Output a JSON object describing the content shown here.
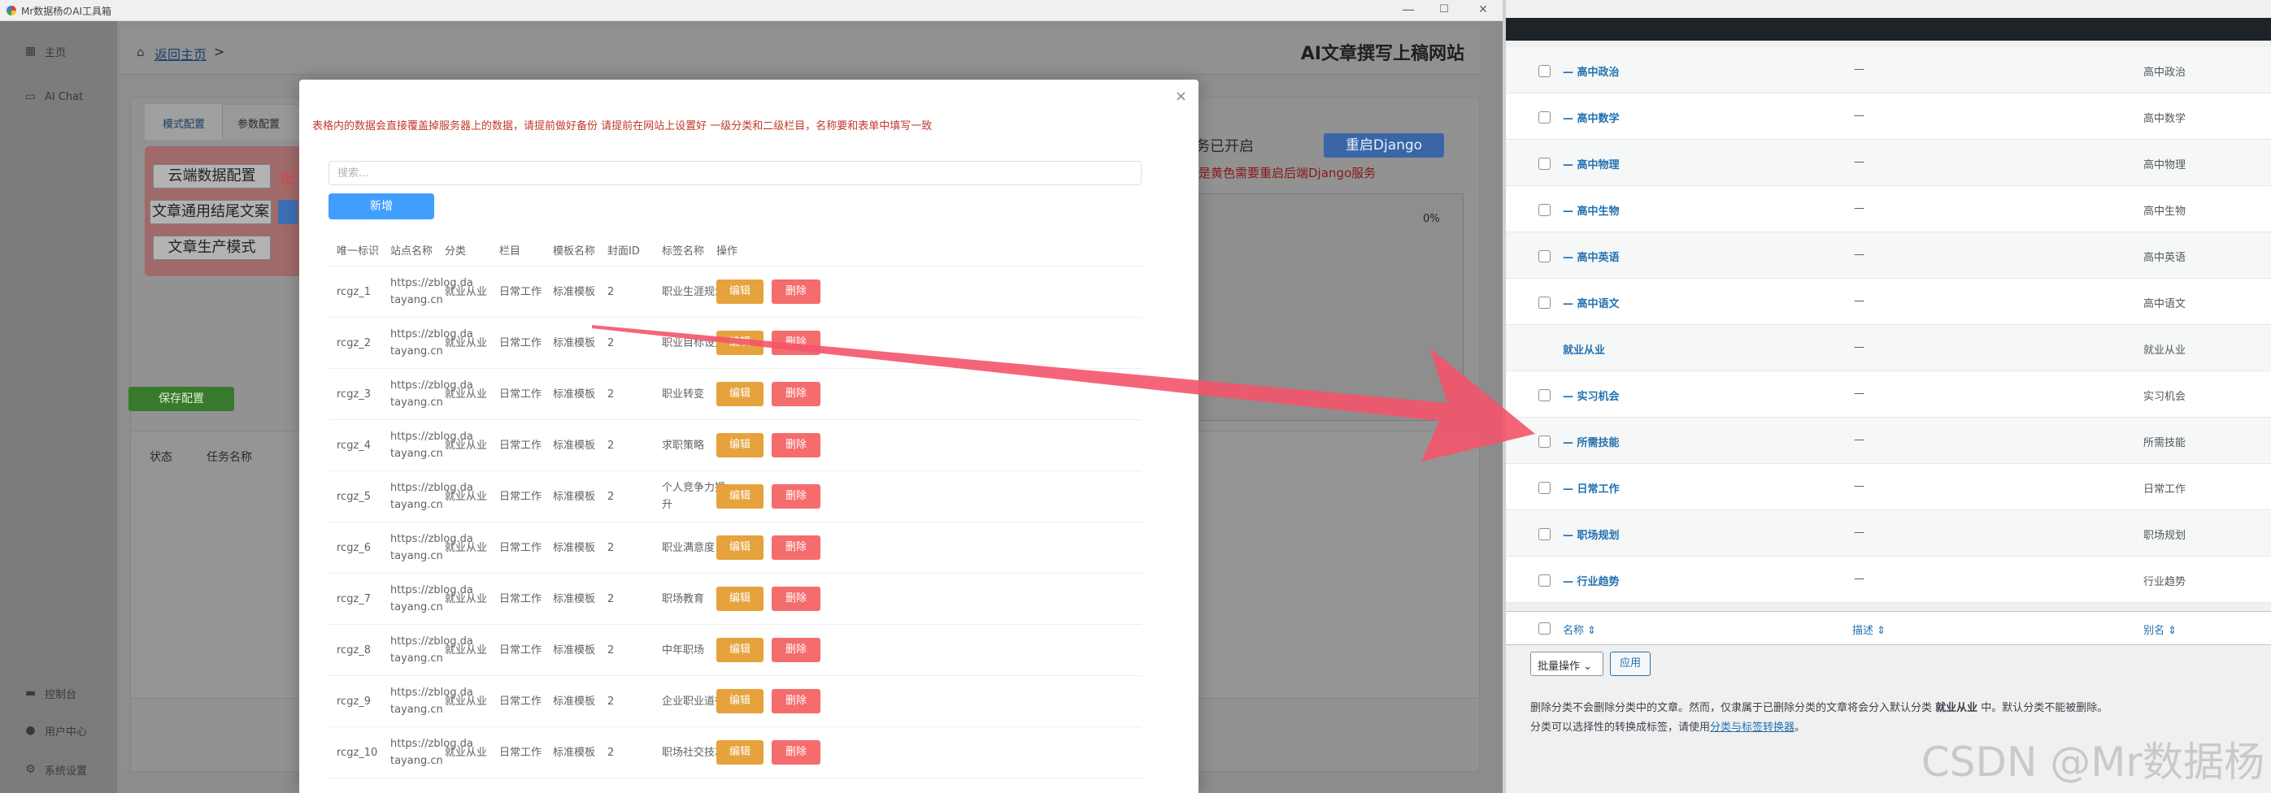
{
  "window": {
    "title": "Mr数据杨のAI工具箱",
    "controls": [
      "—",
      "☐",
      "✕"
    ]
  },
  "sidebar": {
    "items": [
      {
        "label": "主页",
        "icon": "grid-icon"
      },
      {
        "label": "AI Chat",
        "icon": "chat-icon"
      },
      {
        "label": "控制台",
        "icon": "monitor-icon"
      },
      {
        "label": "用户中心",
        "icon": "user-icon"
      },
      {
        "label": "系统设置",
        "icon": "gear-icon"
      }
    ]
  },
  "header": {
    "breadcrumb_link": "返回主页",
    "breadcrumb_sep": ">",
    "title": "AI文章撰写上稿网站"
  },
  "tabs": [
    "模式配置",
    "参数配置"
  ],
  "config_buttons": [
    "云端数据配置",
    "文章通用结尾文案",
    "文章生产模式"
  ],
  "config_tag_partial": "配",
  "save_label": "保存配置",
  "service": {
    "status_text": "务已开启",
    "restart_label": "重启Django",
    "restart_note": "是黄色需要重启后端Django服务",
    "progress_pct": "0%"
  },
  "task_table": {
    "columns": [
      "状态",
      "任务名称"
    ]
  },
  "modal": {
    "close_glyph": "×",
    "warning": "表格内的数据会直接覆盖掉服务器上的数据，请提前做好备份 请提前在网站上设置好 一级分类和二级栏目，名称要和表单中填写一致",
    "search_placeholder": "搜索...",
    "add_label": "新增",
    "columns": [
      "唯一标识",
      "站点名称",
      "分类",
      "栏目",
      "模板名称",
      "封面ID",
      "标签名称",
      "操作"
    ],
    "edit_label": "编辑",
    "delete_label": "删除",
    "rows": [
      {
        "id": "rcgz_1",
        "site_a": "https://zblog.da",
        "site_b": "tayang.cn",
        "category": "就业从业",
        "column": "日常工作",
        "template": "标准模板",
        "cover": "2",
        "tag_a": "职业生涯规划",
        "tag_b": ""
      },
      {
        "id": "rcgz_2",
        "site_a": "https://zblog.da",
        "site_b": "tayang.cn",
        "category": "就业从业",
        "column": "日常工作",
        "template": "标准模板",
        "cover": "2",
        "tag_a": "职业目标设定",
        "tag_b": ""
      },
      {
        "id": "rcgz_3",
        "site_a": "https://zblog.da",
        "site_b": "tayang.cn",
        "category": "就业从业",
        "column": "日常工作",
        "template": "标准模板",
        "cover": "2",
        "tag_a": "职业转变",
        "tag_b": ""
      },
      {
        "id": "rcgz_4",
        "site_a": "https://zblog.da",
        "site_b": "tayang.cn",
        "category": "就业从业",
        "column": "日常工作",
        "template": "标准模板",
        "cover": "2",
        "tag_a": "求职策略",
        "tag_b": ""
      },
      {
        "id": "rcgz_5",
        "site_a": "https://zblog.da",
        "site_b": "tayang.cn",
        "category": "就业从业",
        "column": "日常工作",
        "template": "标准模板",
        "cover": "2",
        "tag_a": "个人竞争力提",
        "tag_b": "升"
      },
      {
        "id": "rcgz_6",
        "site_a": "https://zblog.da",
        "site_b": "tayang.cn",
        "category": "就业从业",
        "column": "日常工作",
        "template": "标准模板",
        "cover": "2",
        "tag_a": "职业满意度",
        "tag_b": ""
      },
      {
        "id": "rcgz_7",
        "site_a": "https://zblog.da",
        "site_b": "tayang.cn",
        "category": "就业从业",
        "column": "日常工作",
        "template": "标准模板",
        "cover": "2",
        "tag_a": "职场教育",
        "tag_b": ""
      },
      {
        "id": "rcgz_8",
        "site_a": "https://zblog.da",
        "site_b": "tayang.cn",
        "category": "就业从业",
        "column": "日常工作",
        "template": "标准模板",
        "cover": "2",
        "tag_a": "中年职场",
        "tag_b": ""
      },
      {
        "id": "rcgz_9",
        "site_a": "https://zblog.da",
        "site_b": "tayang.cn",
        "category": "就业从业",
        "column": "日常工作",
        "template": "标准模板",
        "cover": "2",
        "tag_a": "企业职业道德",
        "tag_b": ""
      },
      {
        "id": "rcgz_10",
        "site_a": "https://zblog.da",
        "site_b": "tayang.cn",
        "category": "就业从业",
        "column": "日常工作",
        "template": "标准模板",
        "cover": "2",
        "tag_a": "职场社交技巧",
        "tag_b": ""
      }
    ]
  },
  "wp": {
    "rows": [
      {
        "name": "— 高中政治",
        "desc": "—",
        "slug": "高中政治",
        "checkbox": true
      },
      {
        "name": "— 高中数学",
        "desc": "—",
        "slug": "高中数学",
        "checkbox": true
      },
      {
        "name": "— 高中物理",
        "desc": "—",
        "slug": "高中物理",
        "checkbox": true
      },
      {
        "name": "— 高中生物",
        "desc": "—",
        "slug": "高中生物",
        "checkbox": true
      },
      {
        "name": "— 高中英语",
        "desc": "—",
        "slug": "高中英语",
        "checkbox": true
      },
      {
        "name": "— 高中语文",
        "desc": "—",
        "slug": "高中语文",
        "checkbox": true
      },
      {
        "name": "就业从业",
        "desc": "—",
        "slug": "就业从业",
        "checkbox": false
      },
      {
        "name": "— 实习机会",
        "desc": "—",
        "slug": "实习机会",
        "checkbox": true
      },
      {
        "name": "— 所需技能",
        "desc": "—",
        "slug": "所需技能",
        "checkbox": true
      },
      {
        "name": "— 日常工作",
        "desc": "—",
        "slug": "日常工作",
        "checkbox": true
      },
      {
        "name": "— 职场规划",
        "desc": "—",
        "slug": "职场规划",
        "checkbox": true
      },
      {
        "name": "— 行业趋势",
        "desc": "—",
        "slug": "行业趋势",
        "checkbox": true
      }
    ],
    "footer_columns": [
      "名称 ⇕",
      "描述 ⇕",
      "别名 ⇕"
    ],
    "bulk_label": "批量操作 ⌄",
    "apply_label": "应用",
    "note1_a": "删除分类不会删除分类中的文章。然而，仅隶属于已删除分类的文章将会分入默认分类 ",
    "note1_b": "就业从业",
    "note1_c": " 中。默认分类不能被删除。",
    "note2_a": "分类可以选择性的转换成标签，请使用",
    "note2_link": "分类与标签转换器",
    "note2_b": "。"
  },
  "watermark": "CSDN @Mr数据杨",
  "colors": {
    "edit": "#e6a23c",
    "delete": "#f56c6c",
    "primary": "#409eff",
    "arrow": "#f4546b",
    "wp_link": "#2271b1"
  }
}
